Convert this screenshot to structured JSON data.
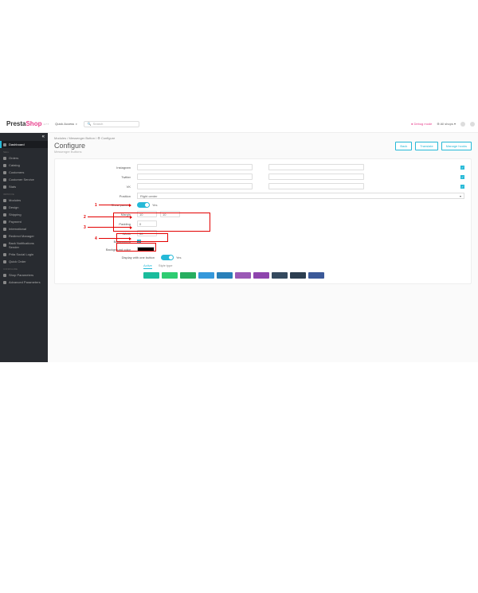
{
  "brand": {
    "presta": "Presta",
    "shop": "Shop",
    "version": "1.7.7"
  },
  "topbar": {
    "quick_access": "Quick Access",
    "search_placeholder": "Search",
    "debug": "Debug mode",
    "shops": "All shops"
  },
  "sidebar": {
    "dashboard": "Dashboard",
    "sections": {
      "sell": "SELL",
      "improve": "IMPROVE",
      "configure": "CONFIGURE"
    },
    "items": {
      "orders": "Orders",
      "catalog": "Catalog",
      "customers": "Customers",
      "customer_service": "Customer Service",
      "stats": "Stats",
      "modules": "Modules",
      "design": "Design",
      "shipping": "Shipping",
      "payment": "Payment",
      "international": "International",
      "redirect_manager": "Redirect Manager",
      "back_notifications": "Back Notifications Sender",
      "prita_social": "Prita Social Login",
      "quick_order": "Quick Order",
      "shop_parameters": "Shop Parameters",
      "advanced_parameters": "Advanced Parameters"
    }
  },
  "breadcrumb": "Modules / Messenger Button / ⚙ Configure",
  "page": {
    "title": "Configure",
    "subtitle": "Messenger Buttons"
  },
  "buttons": {
    "back": "Back",
    "translate": "Translate",
    "manage_hooks": "Manage hooks"
  },
  "form": {
    "instagram": "Instagram",
    "twitter": "Twitter",
    "vk": "VK",
    "position": "Position",
    "position_value": "Right center",
    "show_params": "Show params",
    "yes": "Yes",
    "margin": "Margin",
    "margin_v1": "10",
    "margin_v2": "10",
    "padding": "Padding",
    "padding_v1": "0",
    "width": "Width",
    "width_v": "30",
    "background": "Background",
    "background_color": "Background color",
    "display_one": "Display with one button",
    "active_tab": "Active",
    "style_tab": "Style type"
  },
  "annotations": {
    "n1": "1",
    "n2": "2",
    "n3": "3",
    "n4": "4"
  },
  "swatches": [
    "#1abc9c",
    "#2ecc71",
    "#27ae60",
    "#3498db",
    "#2980b9",
    "#9b59b6",
    "#8e44ad",
    "#34495e",
    "#2c3e50",
    "#3b5998"
  ]
}
